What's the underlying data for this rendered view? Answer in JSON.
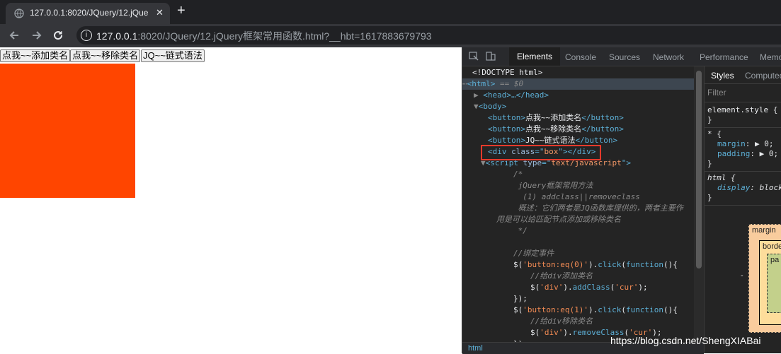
{
  "browser": {
    "tab_title": "127.0.0.1:8020/JQuery/12.jQue",
    "tab_close": "✕",
    "new_tab": "+",
    "url_host": "127.0.0.1",
    "url_rest": ":8020/JQuery/12.jQuery框架常用函数.html?__hbt=1617883679793"
  },
  "page": {
    "buttons": [
      "点我~~添加类名",
      "点我~~移除类名",
      "JQ~~链式语法"
    ],
    "box_color": "#ff4500"
  },
  "devtools": {
    "tabs": [
      "Elements",
      "Console",
      "Sources",
      "Network",
      "Performance",
      "Memo"
    ],
    "active_tab": "Elements",
    "dom": {
      "doctype": "<!DOCTYPE html>",
      "html_open": "<html>",
      "html_suffix": " == $0",
      "head": "<head>…</head>",
      "body_open": "<body>",
      "button1_text": "点我~~添加类名",
      "button2_text": "点我~~移除类名",
      "button3_text": "JQ~~链式语法",
      "div_class": "box",
      "script_type": "text/javascript"
    },
    "code": {
      "c1": "/*",
      "c2": " jQuery框架常用方法",
      "c3": "  (1) addclass||removeclass",
      "c4": " 概述：它们两者是JQ函数库提供的，两者主要作",
      "c5": "用是可以给匹配节点添加或移除类名",
      "c6": " */",
      "c7": "//绑定事件",
      "c8_sel": "'button:eq(0)'",
      "c9": "//给div添加类名",
      "c10_sel": "'div'",
      "c10_arg": "'cur'",
      "c12_sel": "'button:eq(1)'",
      "c13": "//给div移除类名",
      "c14_sel": "'div'",
      "c14_arg": "'cur'"
    },
    "breadcrumb": "html",
    "styles": {
      "tabs": [
        "Styles",
        "Computed"
      ],
      "filter_placeholder": "Filter",
      "element_style": "element.style {",
      "close_brace": "}",
      "rule1_selector": "* {",
      "rule1_props": [
        [
          "margin",
          "0;"
        ],
        [
          "padding",
          "0;"
        ]
      ],
      "rule2_selector": "html {",
      "rule2_prop": [
        "display",
        "block"
      ],
      "boxmodel": {
        "margin": "margin",
        "border": "borde",
        "padding": "pa",
        "dash": "-"
      }
    }
  },
  "watermark": "https://blog.csdn.net/ShengXIABai"
}
